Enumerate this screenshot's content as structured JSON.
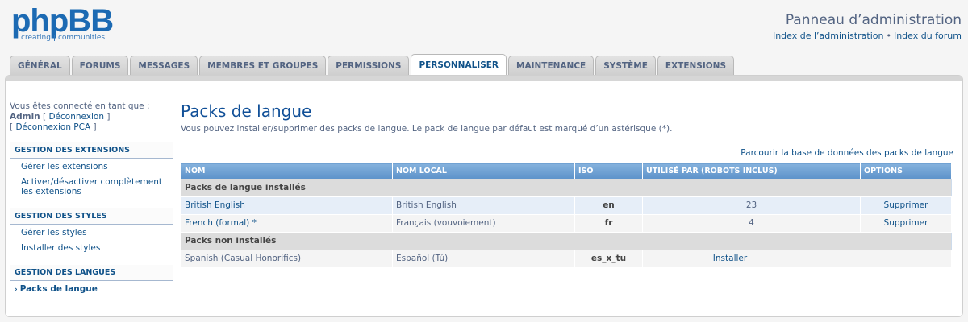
{
  "logo": {
    "main": "phpBB",
    "sub_left": "creating",
    "sub_right": "communities"
  },
  "header": {
    "title": "Panneau d’administration",
    "link_admin_index": "Index de l’administration",
    "link_separator": "•",
    "link_forum_index": "Index du forum"
  },
  "tabs": [
    {
      "label": "GÉNÉRAL"
    },
    {
      "label": "FORUMS"
    },
    {
      "label": "MESSAGES"
    },
    {
      "label": "MEMBRES ET GROUPES"
    },
    {
      "label": "PERMISSIONS"
    },
    {
      "label": "PERSONNALISER",
      "active": true
    },
    {
      "label": "MAINTENANCE"
    },
    {
      "label": "SYSTÈME"
    },
    {
      "label": "EXTENSIONS"
    }
  ],
  "sidebar": {
    "logged_in_text": "Vous êtes connecté en tant que :",
    "username": "Admin",
    "logout": "Déconnexion",
    "logout_acp": "Déconnexion PCA",
    "sections": [
      {
        "title": "GESTION DES EXTENSIONS",
        "items": [
          {
            "label": "Gérer les extensions"
          },
          {
            "label": "Activer/désactiver complètement les extensions"
          }
        ]
      },
      {
        "title": "GESTION DES STYLES",
        "items": [
          {
            "label": "Gérer les styles"
          },
          {
            "label": "Installer des styles"
          }
        ]
      },
      {
        "title": "GESTION DES LANGUES",
        "items": [
          {
            "label": "Packs de langue",
            "active": true
          }
        ]
      }
    ]
  },
  "main": {
    "title": "Packs de langue",
    "description": "Vous pouvez installer/supprimer des packs de langue. Le pack de langue par défaut est marqué d’un astérisque (*).",
    "browse_link": "Parcourir la base de données des packs de langue",
    "table": {
      "headers": [
        "NOM",
        "NOM LOCAL",
        "ISO",
        "UTILISÉ PAR (ROBOTS INCLUS)",
        "OPTIONS"
      ],
      "installed_section": "Packs de langue installés",
      "installed": [
        {
          "name": "British English",
          "local": "British English",
          "iso": "en",
          "used_by": "23",
          "option": "Supprimer"
        },
        {
          "name": "French (formal) *",
          "local": "Français (vouvoiement)",
          "iso": "fr",
          "used_by": "4",
          "option": "Supprimer"
        }
      ],
      "not_installed_section": "Packs non installés",
      "not_installed": [
        {
          "name": "Spanish (Casual Honorifics)",
          "local": "Español (Tú)",
          "iso": "es_x_tu",
          "option": "Installer"
        }
      ]
    }
  },
  "colors": {
    "accent": "#105289",
    "table_header": "#6fa3d7",
    "title": "#115098"
  }
}
